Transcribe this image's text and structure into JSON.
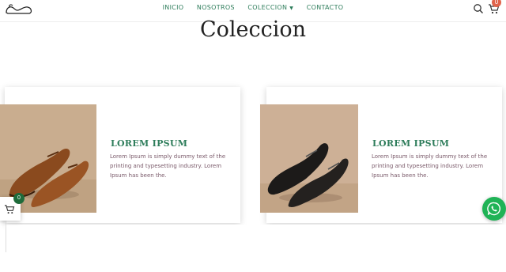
{
  "nav": {
    "items": [
      "INICIO",
      "NOSOTROS",
      "COLECCION",
      "CONTACTO"
    ]
  },
  "header": {
    "cart_count": "0"
  },
  "section": {
    "title": "Coleccion"
  },
  "products": [
    {
      "name": "LOREM IPSUM",
      "description": "Lorem Ipsum is simply dummy text of the printing and typesetting industry. Lorem Ipsum has been the.",
      "image": "brown-oxford-shoes"
    },
    {
      "name": "LOREM IPSUM",
      "description": "Lorem Ipsum is simply dummy text of the printing and typesetting industry. Lorem Ipsum has been the.",
      "image": "black-oxford-shoes"
    }
  ],
  "floating_cart": {
    "count": "0"
  },
  "colors": {
    "accent_green": "#2e7d5b",
    "badge_orange": "#e0644c",
    "whatsapp_green": "#1fb356"
  },
  "icons": [
    "logo-shoe-icon",
    "search-icon",
    "cart-icon",
    "chevron-down-icon",
    "whatsapp-icon"
  ]
}
